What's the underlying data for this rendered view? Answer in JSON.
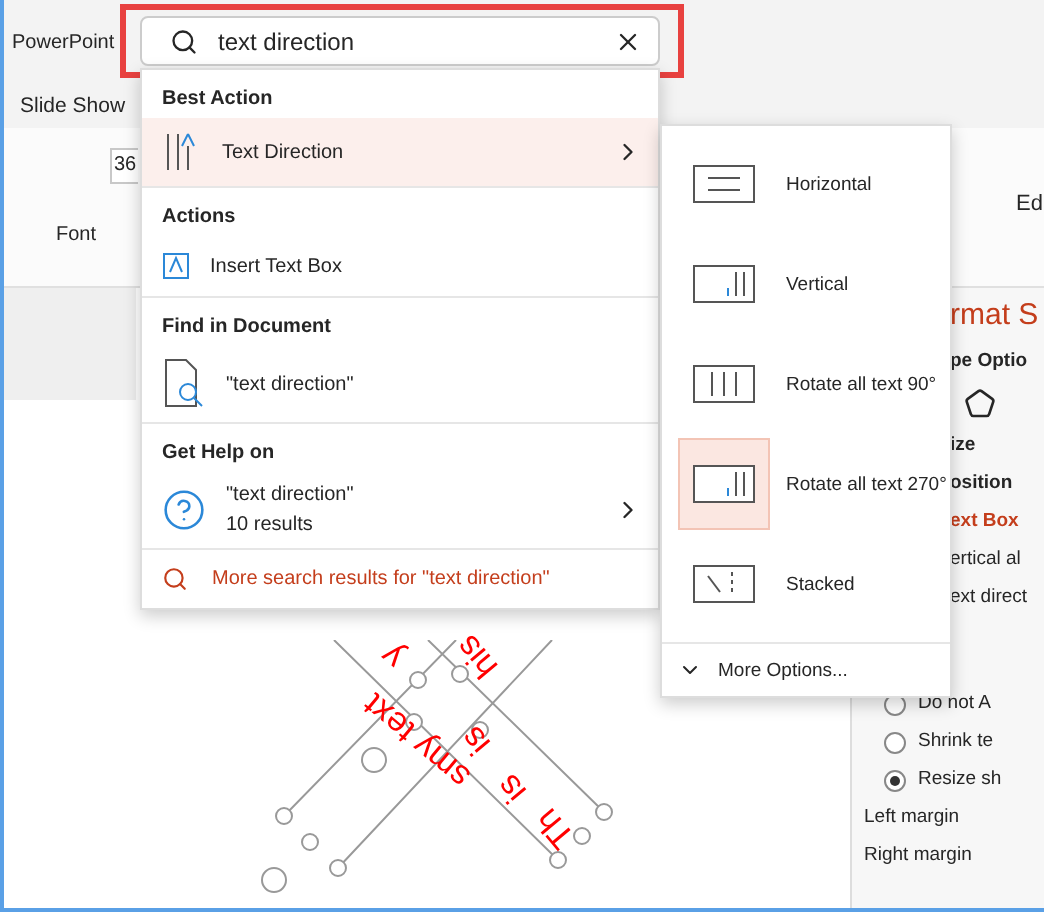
{
  "app_title": "PowerPoint",
  "search": {
    "value": "text direction",
    "highlighted": true
  },
  "ribbon": {
    "tab": "Slide Show",
    "font_size": "36",
    "group_label": "Font",
    "edit_label": "Ed"
  },
  "results": {
    "sections": [
      {
        "heading": "Best Action",
        "items": [
          {
            "kind": "textdir",
            "label": "Text Direction",
            "selected": true,
            "submenu": true
          }
        ]
      },
      {
        "heading": "Actions",
        "items": [
          {
            "kind": "textbox",
            "label": "Insert Text Box",
            "selected": false,
            "submenu": false
          }
        ]
      },
      {
        "heading": "Find in Document",
        "items": [
          {
            "kind": "document",
            "label": "\"text direction\"",
            "selected": false,
            "submenu": false
          }
        ]
      },
      {
        "heading": "Get Help on",
        "items": [
          {
            "kind": "help",
            "label": "\"text direction\"",
            "sublabel": "10 results",
            "selected": false,
            "submenu": true
          }
        ]
      }
    ],
    "more": "More search results for \"text direction\""
  },
  "submenu": {
    "items": [
      {
        "kind": "horizontal",
        "label": "Horizontal",
        "selected": false
      },
      {
        "kind": "vertical",
        "label": "Vertical",
        "selected": false
      },
      {
        "kind": "rot90",
        "label": "Rotate all text 90°",
        "selected": false
      },
      {
        "kind": "rot270",
        "label": "Rotate all text 270°",
        "selected": true
      },
      {
        "kind": "stacked",
        "label": "Stacked",
        "selected": false
      }
    ],
    "more": "More Options..."
  },
  "pane": {
    "title": "rmat S",
    "tab": "pe Optio",
    "sections": [
      {
        "label": "ize",
        "kind": "heading"
      },
      {
        "label": "osition",
        "kind": "heading"
      },
      {
        "label": "ext Box",
        "kind": "active"
      },
      {
        "label": "ertical al",
        "kind": "field"
      },
      {
        "label": "ext direct",
        "kind": "field"
      }
    ],
    "radios": [
      {
        "label": "Do not A",
        "selected": false
      },
      {
        "label": "Shrink te",
        "selected": false
      },
      {
        "label": "Resize sh",
        "selected": true
      }
    ],
    "margins": [
      "Left margin",
      "Right margin"
    ]
  },
  "slide_texts": [
    "y",
    "his",
    "smy text",
    "is",
    "is",
    "Th"
  ]
}
